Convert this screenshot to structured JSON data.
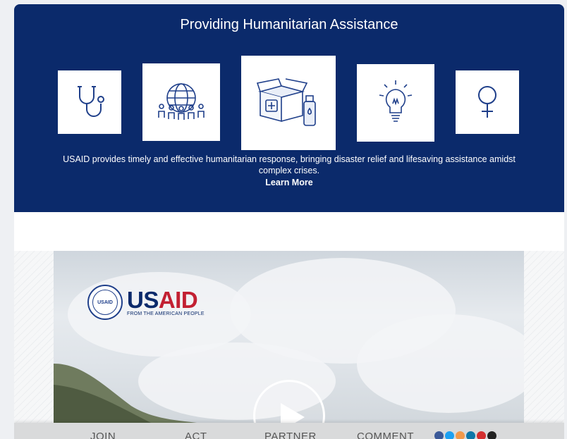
{
  "hero": {
    "title": "Providing Humanitarian Assistance",
    "description": "USAID provides timely and effective humanitarian response, bringing disaster relief and lifesaving assistance amidst complex crises.",
    "learn_more": "Learn More",
    "icons": [
      "stethoscope-icon",
      "globe-people-icon",
      "medical-box-icon",
      "lightbulb-icon",
      "female-symbol-icon"
    ]
  },
  "video": {
    "logo_us": "US",
    "logo_aid": "AID",
    "tagline": "FROM THE AMERICAN PEOPLE",
    "seal_text": "USAID",
    "icons": [
      "play-icon"
    ]
  },
  "nav": {
    "items": [
      "JOIN",
      "ACT",
      "PARTNER",
      "COMMENT"
    ],
    "social_icons": [
      "facebook-icon",
      "twitter-icon",
      "rss-icon",
      "linkedin-icon",
      "youtube-icon",
      "instagram-icon"
    ]
  },
  "colors": {
    "hero_bg": "#0b2a6b",
    "brand_red": "#c22032",
    "brand_blue": "#0b2a6b"
  }
}
